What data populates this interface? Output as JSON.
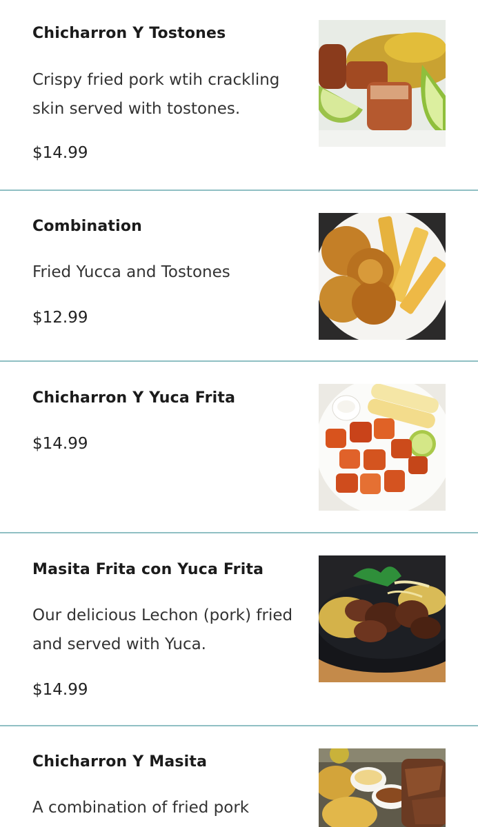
{
  "colors": {
    "divider": "#8fbfc3",
    "text": "#222222"
  },
  "items": [
    {
      "name": "Chicharron Y Tostones",
      "description": "Crispy fried pork wtih crackling skin served with tostones.",
      "price": "$14.99",
      "image": "chicharron-tostones-photo"
    },
    {
      "name": "Combination",
      "description": "Fried Yucca and Tostones",
      "price": "$12.99",
      "image": "yucca-tostones-photo"
    },
    {
      "name": "Chicharron Y Yuca Frita",
      "description": "",
      "price": "$14.99",
      "image": "chicharron-yuca-photo"
    },
    {
      "name": "Masita Frita con Yuca Frita",
      "description": "Our delicious Lechon (pork) fried and served with Yuca.",
      "price": "$14.99",
      "image": "masita-skillet-photo"
    },
    {
      "name": "Chicharron Y Masita",
      "description": "A combination of fried pork",
      "price": "",
      "image": "chicharron-masita-photo"
    }
  ]
}
